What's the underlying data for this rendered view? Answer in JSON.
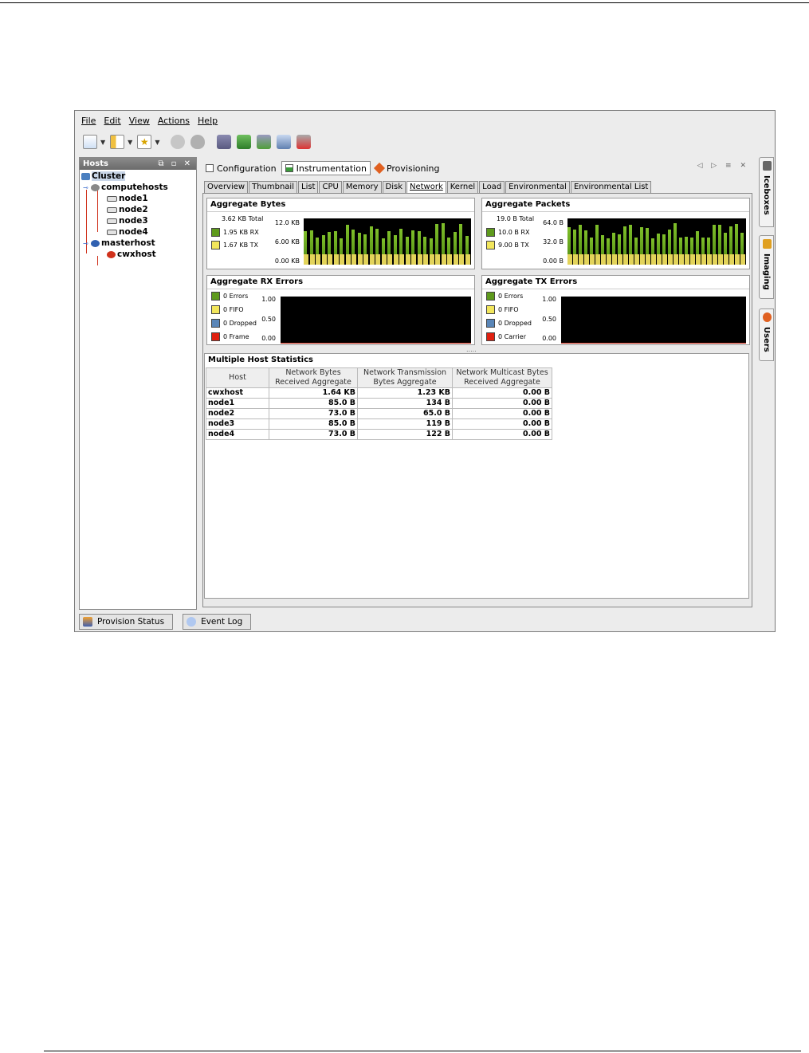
{
  "menu": [
    "File",
    "Edit",
    "View",
    "Actions",
    "Help"
  ],
  "hosts_panel": {
    "title": "Hosts",
    "tree": [
      {
        "label": "Cluster",
        "level": 0,
        "bold": true
      },
      {
        "label": "computehosts",
        "level": 1,
        "bold": true
      },
      {
        "label": "node1",
        "level": 2
      },
      {
        "label": "node2",
        "level": 2
      },
      {
        "label": "node3",
        "level": 2
      },
      {
        "label": "node4",
        "level": 2
      },
      {
        "label": "masterhost",
        "level": 1,
        "bold": true
      },
      {
        "label": "cwxhost",
        "level": 2
      }
    ]
  },
  "top_tabs": [
    "Configuration",
    "Instrumentation",
    "Provisioning"
  ],
  "active_top_tab": "Instrumentation",
  "sub_tabs": [
    "Overview",
    "Thumbnail",
    "List",
    "CPU",
    "Memory",
    "Disk",
    "Network",
    "Kernel",
    "Load",
    "Environmental",
    "Environmental List"
  ],
  "active_sub_tab": "Network",
  "charts": {
    "bytes": {
      "title": "Aggregate Bytes",
      "total": "3.62 KB Total",
      "legend": [
        {
          "label": "1.95 KB RX",
          "color": "#5e9a1c"
        },
        {
          "label": "1.67 KB TX",
          "color": "#f2e65c"
        }
      ],
      "yticks": [
        "12.0 KB",
        "6.00 KB",
        "0.00 KB"
      ]
    },
    "packets": {
      "title": "Aggregate Packets",
      "total": "19.0 B Total",
      "legend": [
        {
          "label": "10.0 B RX",
          "color": "#5e9a1c"
        },
        {
          "label": "9.00 B TX",
          "color": "#f2e65c"
        }
      ],
      "yticks": [
        "64.0 B",
        "32.0 B",
        "0.00 B"
      ]
    },
    "rx_errors": {
      "title": "Aggregate RX Errors",
      "legend": [
        {
          "label": "0 Errors",
          "color": "#5e9a1c"
        },
        {
          "label": "0 FIFO",
          "color": "#f2e65c"
        },
        {
          "label": "0 Dropped",
          "color": "#5a86b8"
        },
        {
          "label": "0 Frame",
          "color": "#e02010"
        }
      ],
      "yticks": [
        "1.00",
        "0.50",
        "0.00"
      ]
    },
    "tx_errors": {
      "title": "Aggregate TX Errors",
      "legend": [
        {
          "label": "0 Errors",
          "color": "#5e9a1c"
        },
        {
          "label": "0 FIFO",
          "color": "#f2e65c"
        },
        {
          "label": "0 Dropped",
          "color": "#5a86b8"
        },
        {
          "label": "0 Carrier",
          "color": "#e02010"
        }
      ],
      "yticks": [
        "1.00",
        "0.50",
        "0.00"
      ]
    }
  },
  "stats": {
    "title": "Multiple Host Statistics",
    "headers": [
      [
        "Host"
      ],
      [
        "Network Bytes",
        "Received Aggregate"
      ],
      [
        "Network Transmission",
        "Bytes Aggregate"
      ],
      [
        "Network Multicast Bytes",
        "Received Aggregate"
      ]
    ],
    "rows": [
      [
        "cwxhost",
        "1.64 KB",
        "1.23 KB",
        "0.00 B"
      ],
      [
        "node1",
        "85.0 B",
        "134 B",
        "0.00 B"
      ],
      [
        "node2",
        "73.0 B",
        "65.0 B",
        "0.00 B"
      ],
      [
        "node3",
        "85.0 B",
        "119 B",
        "0.00 B"
      ],
      [
        "node4",
        "73.0 B",
        "122 B",
        "0.00 B"
      ]
    ]
  },
  "status_tabs": [
    "Provision Status",
    "Event Log"
  ],
  "side_tabs": [
    "Iceboxes",
    "Imaging",
    "Users"
  ]
}
